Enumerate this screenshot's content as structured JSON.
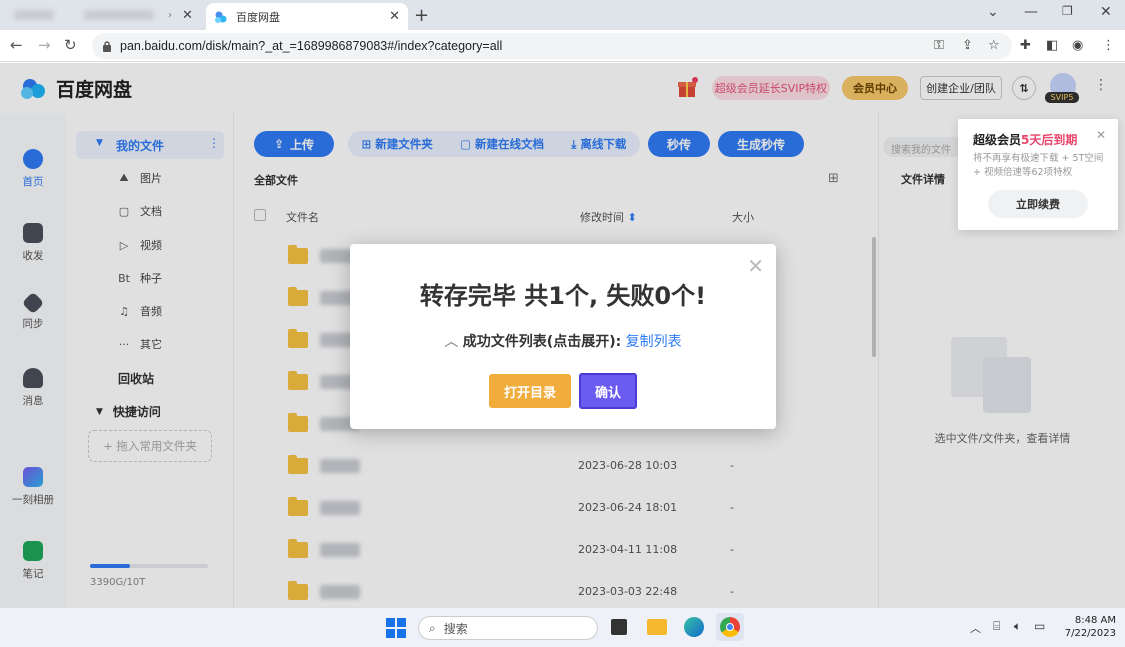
{
  "browser": {
    "active_tab_title": "百度网盘",
    "url": "pan.baidu.com/disk/main?_at_=1689986879083#/index?category=all"
  },
  "header": {
    "logo_name": "百度网盘",
    "promo_pill": "超级会员延长SVIP特权",
    "member_center": "会员中心",
    "create_team": "创建企业/团队",
    "svip_badge": "SVIP5"
  },
  "leftnav": {
    "items": [
      {
        "label": "首页"
      },
      {
        "label": "收发"
      },
      {
        "label": "同步"
      },
      {
        "label": "消息"
      },
      {
        "label": "一刻相册"
      },
      {
        "label": "笔记"
      }
    ]
  },
  "sidebar": {
    "my_files": "我的文件",
    "items": [
      {
        "label": "图片"
      },
      {
        "label": "文档"
      },
      {
        "label": "视频"
      },
      {
        "label": "种子"
      },
      {
        "label": "音频"
      },
      {
        "label": "其它"
      }
    ],
    "recycle": "回收站",
    "quick_access": "快捷访问",
    "drag_hint": "+ 拖入常用文件夹",
    "storage": "3390G/10T"
  },
  "toolbar": {
    "upload": "上传",
    "new_folder": "新建文件夹",
    "new_doc": "新建在线文档",
    "offline_dl": "离线下载",
    "instant": "秒传",
    "gen_instant": "生成秒传",
    "search_placeholder": "搜索我的文件"
  },
  "filelist": {
    "breadcrumb": "全部文件",
    "col_name": "文件名",
    "col_modified": "修改时间",
    "col_size": "大小",
    "rows": [
      {
        "date": "",
        "size": ""
      },
      {
        "date": "",
        "size": ""
      },
      {
        "date": "",
        "size": ""
      },
      {
        "date": "",
        "size": ""
      },
      {
        "date": "",
        "size": ""
      },
      {
        "date": "2023-06-28 10:03",
        "size": "-"
      },
      {
        "date": "2023-06-24 18:01",
        "size": "-"
      },
      {
        "date": "2023-04-11 11:08",
        "size": "-"
      },
      {
        "date": "2023-03-03 22:48",
        "size": "-"
      }
    ]
  },
  "detail": {
    "title": "文件详情",
    "empty_hint": "选中文件/文件夹，查看详情"
  },
  "promo_popup": {
    "title_prefix": "超级会员",
    "title_highlight": "5天后到期",
    "desc": "将不再享有极速下载 + 5T空间 + 视频倍速等62项特权",
    "button": "立即续费"
  },
  "modal": {
    "title": "转存完毕 共1个, 失败0个!",
    "list_label": "成功文件列表(点击展开):",
    "copy_list": "复制列表",
    "open_dir": "打开目录",
    "confirm": "确认"
  },
  "taskbar": {
    "search": "搜索",
    "time": "8:48 AM",
    "date": "7/22/2023"
  }
}
